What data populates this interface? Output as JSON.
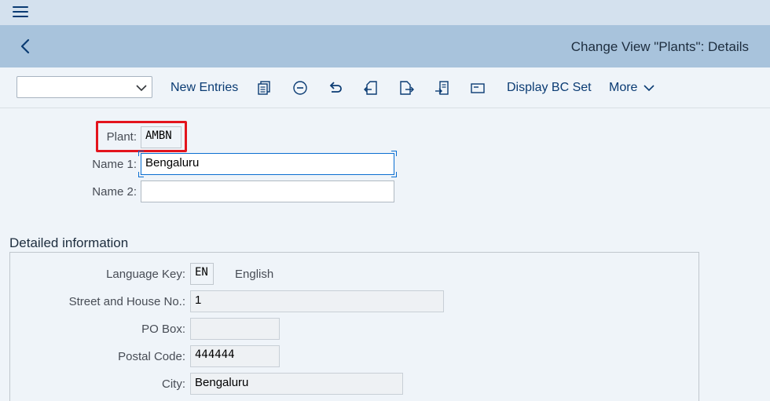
{
  "topbar": {
    "menu_icon": "hamburger-menu-icon"
  },
  "titlebar": {
    "back_icon": "chevron-left-icon",
    "title": "Change View \"Plants\": Details"
  },
  "toolbar": {
    "selector_value": "",
    "new_entries": "New Entries",
    "display_bc_set": "Display BC Set",
    "more": "More",
    "icons": [
      "copy-icon",
      "delete-icon",
      "undo-icon",
      "previous-entry-icon",
      "next-entry-icon",
      "transport-icon",
      "display-icon"
    ]
  },
  "header": {
    "plant_label": "Plant:",
    "plant_value": "AMBN",
    "name1_label": "Name 1:",
    "name1_value": "Bengaluru",
    "name2_label": "Name 2:",
    "name2_value": ""
  },
  "details": {
    "title": "Detailed information",
    "language_key_label": "Language Key:",
    "language_key_value": "EN",
    "language_text": "English",
    "street_label": "Street and House No.:",
    "street_value": "1",
    "po_box_label": "PO Box:",
    "po_box_value": "",
    "postal_code_label": "Postal Code:",
    "postal_code_value": "444444",
    "city_label": "City:",
    "city_value": "Bengaluru"
  },
  "colors": {
    "shell_bg": "#eff4f9",
    "title_bar": "#a8c3dc",
    "top_bar": "#d4e1ee",
    "link": "#0a3b73",
    "highlight": "#e3141d"
  }
}
